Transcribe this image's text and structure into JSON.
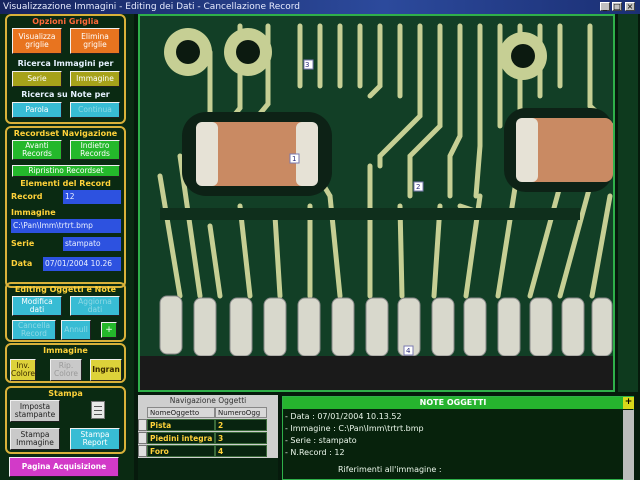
{
  "window": {
    "title": "Visualizzazione Immagini - Editing dei Dati - Cancellazione Record"
  },
  "opzioni_griglia": {
    "title": "Opzioni Griglia",
    "visualizza": "Visualizza griglie",
    "elimina": "Elimina griglie"
  },
  "ricerca_immagini": {
    "title": "Ricerca Immagini per",
    "serie": "Serie",
    "immagine": "Immagine"
  },
  "ricerca_note": {
    "title": "Ricerca su Note per",
    "parola": "Parola",
    "continua": "Continua"
  },
  "recordset_nav": {
    "title": "Recordset Navigazione",
    "avanti": "Avanti Records",
    "indietro": "Indietro Records",
    "ripristino": "Ripristino Recordset"
  },
  "elementi_record": {
    "title": "Elementi del Record",
    "record_label": "Record",
    "record_value": "12",
    "immagine_label": "Immagine",
    "immagine_value": "C:\\Pan\\Imm\\trtrt.bmp",
    "serie_label": "Serie",
    "serie_value": "stampato",
    "data_label": "Data",
    "data_value": "07/01/2004 10.26"
  },
  "editing": {
    "title": "Editing Oggetti e Note",
    "modifica": "Modifica dati",
    "aggiorna": "Aggiorna dati",
    "cancella": "Cancella Record",
    "annull": "Annull",
    "plus": "+"
  },
  "immagine_panel": {
    "title": "Immagine",
    "inv_colore": "Inv. Colore",
    "rip_colore": "Rip. Colore",
    "ingran": "Ingran"
  },
  "stampa": {
    "title": "Stampa",
    "imposta": "Imposta stampante",
    "stampa_immagine": "Stampa Immagine",
    "stampa_report": "Stampa Report"
  },
  "pagina_acquisizione": "Pagina Acquisizione",
  "navigazione_oggetti": {
    "title": "Navigazione Oggetti",
    "columns": [
      "NomeOggetto",
      "NumeroOgg"
    ],
    "rows": [
      {
        "nome": "Pista",
        "numero": "2"
      },
      {
        "nome": "Piedini integra",
        "numero": "3"
      },
      {
        "nome": "Foro",
        "numero": "4"
      }
    ]
  },
  "note_oggetti": {
    "title": "NOTE OGGETTI",
    "plus": "+",
    "lines": [
      "- Data : 07/01/2004 10.13.52",
      "- Immagine : C:\\Pan\\Imm\\trtrt.bmp",
      "- Serie : stampato",
      "- N.Record : 12",
      "Riferimenti all'immagine :"
    ]
  },
  "viewer": {
    "markers": [
      "3",
      "1",
      "2",
      "4"
    ]
  },
  "colors": {
    "panel_border": "#d9b23a",
    "title_yellow": "#ffd23a",
    "field_blue": "#2d52e0",
    "pcb_green": "#123f26",
    "trace": "#c6cf94",
    "accent_green": "#26b32e"
  }
}
